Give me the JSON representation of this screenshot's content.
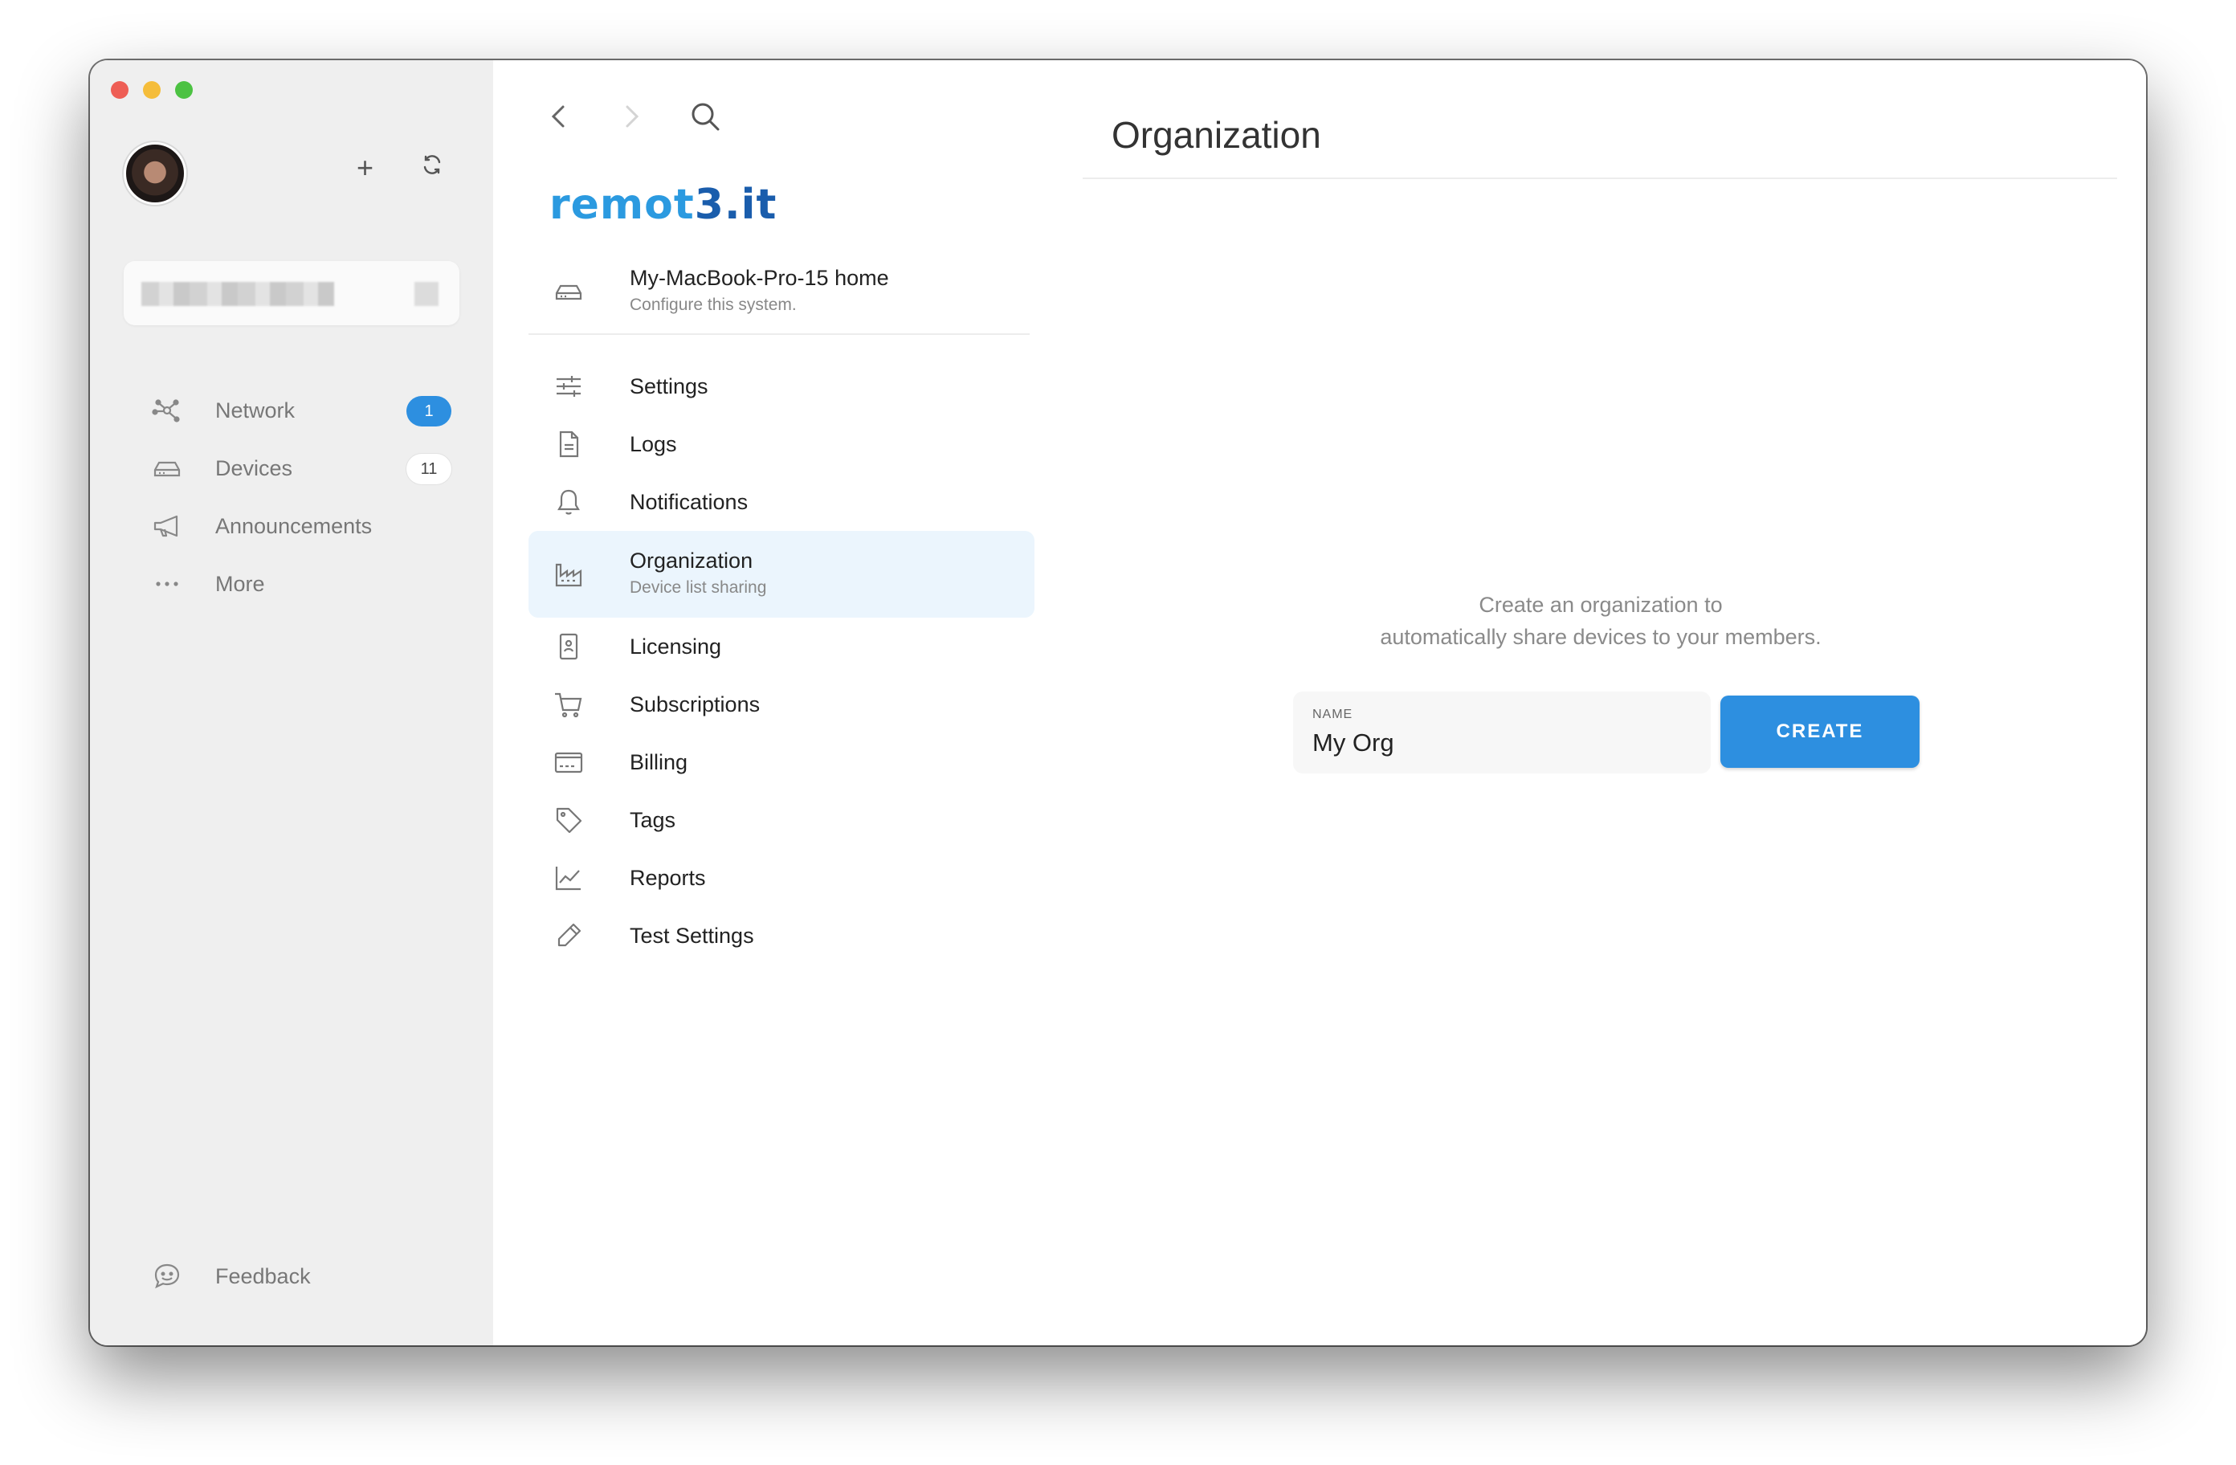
{
  "sidebar": {
    "items": [
      {
        "label": "Network",
        "icon": "network-icon",
        "badge": "1"
      },
      {
        "label": "Devices",
        "icon": "devices-icon",
        "badge": "11"
      },
      {
        "label": "Announcements",
        "icon": "megaphone-icon"
      },
      {
        "label": "More",
        "icon": "more-dots-icon"
      }
    ],
    "feedback_label": "Feedback"
  },
  "middle": {
    "logo_text_a": "remot",
    "logo_text_b": "3.it",
    "device": {
      "title": "My-MacBook-Pro-15 home",
      "subtitle": "Configure this system."
    },
    "menu": [
      {
        "label": "Settings",
        "icon": "sliders-icon"
      },
      {
        "label": "Logs",
        "icon": "document-icon"
      },
      {
        "label": "Notifications",
        "icon": "bell-icon"
      },
      {
        "label": "Organization",
        "sub": "Device list sharing",
        "icon": "factory-icon",
        "active": true
      },
      {
        "label": "Licensing",
        "icon": "license-icon"
      },
      {
        "label": "Subscriptions",
        "icon": "cart-icon"
      },
      {
        "label": "Billing",
        "icon": "billing-icon"
      },
      {
        "label": "Tags",
        "icon": "tag-icon"
      },
      {
        "label": "Reports",
        "icon": "chart-line-icon"
      },
      {
        "label": "Test Settings",
        "icon": "pencil-icon"
      }
    ]
  },
  "main": {
    "title": "Organization",
    "message_line1": "Create an organization to",
    "message_line2": "automatically share devices to your members.",
    "name_label": "NAME",
    "name_value": "My Org",
    "create_label": "CREATE"
  },
  "colors": {
    "accent": "#2d8fe0",
    "active_bg": "#ebf5fd",
    "sidebar_bg": "#efefef"
  }
}
